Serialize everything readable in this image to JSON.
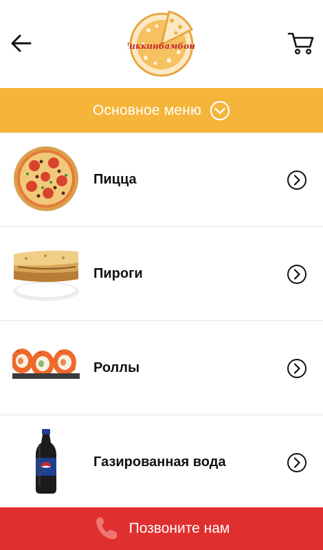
{
  "header": {
    "logo_text": "Чиккинбамбони",
    "back_icon": "arrow-left-icon",
    "cart_icon": "cart-icon"
  },
  "menu_selector": {
    "label": "Основное меню",
    "icon": "chevron-down-circle-icon",
    "color": "#f4b53a"
  },
  "categories": [
    {
      "label": "Пицца",
      "image": "pizza-image"
    },
    {
      "label": "Пироги",
      "image": "pie-image"
    },
    {
      "label": "Роллы",
      "image": "rolls-image"
    },
    {
      "label": "Газированная вода",
      "image": "soda-bottle-image"
    }
  ],
  "call_bar": {
    "label": "Позвоните нам",
    "icon": "phone-icon",
    "color": "#e02f2f"
  }
}
